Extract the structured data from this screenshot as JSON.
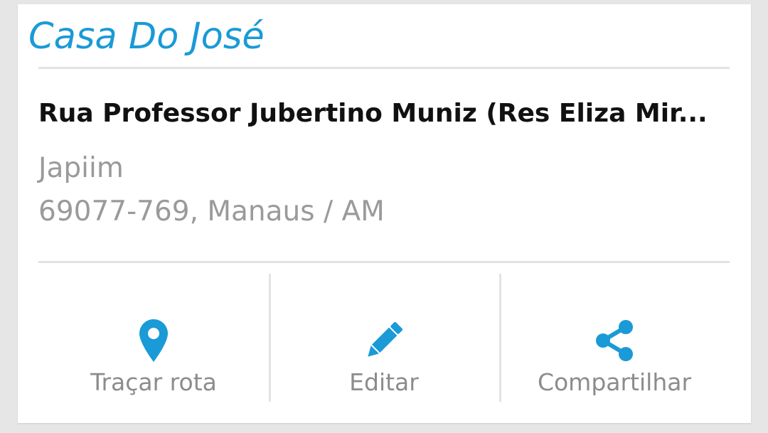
{
  "place": {
    "name": "Casa Do José",
    "street": "Rua Professor Jubertino Muniz (Res Eliza Mir...",
    "district": "Japiim",
    "city_line": "69077-769, Manaus / AM"
  },
  "actions": [
    {
      "label": "Traçar rota",
      "icon": "map-pin-icon"
    },
    {
      "label": "Editar",
      "icon": "pencil-icon"
    },
    {
      "label": "Compartilhar",
      "icon": "share-icon"
    }
  ],
  "colors": {
    "accent": "#1a9ad6",
    "text_primary": "#111111",
    "text_secondary": "#9a9a9a",
    "divider": "#e3e3e3",
    "background": "#e6e6e6"
  }
}
